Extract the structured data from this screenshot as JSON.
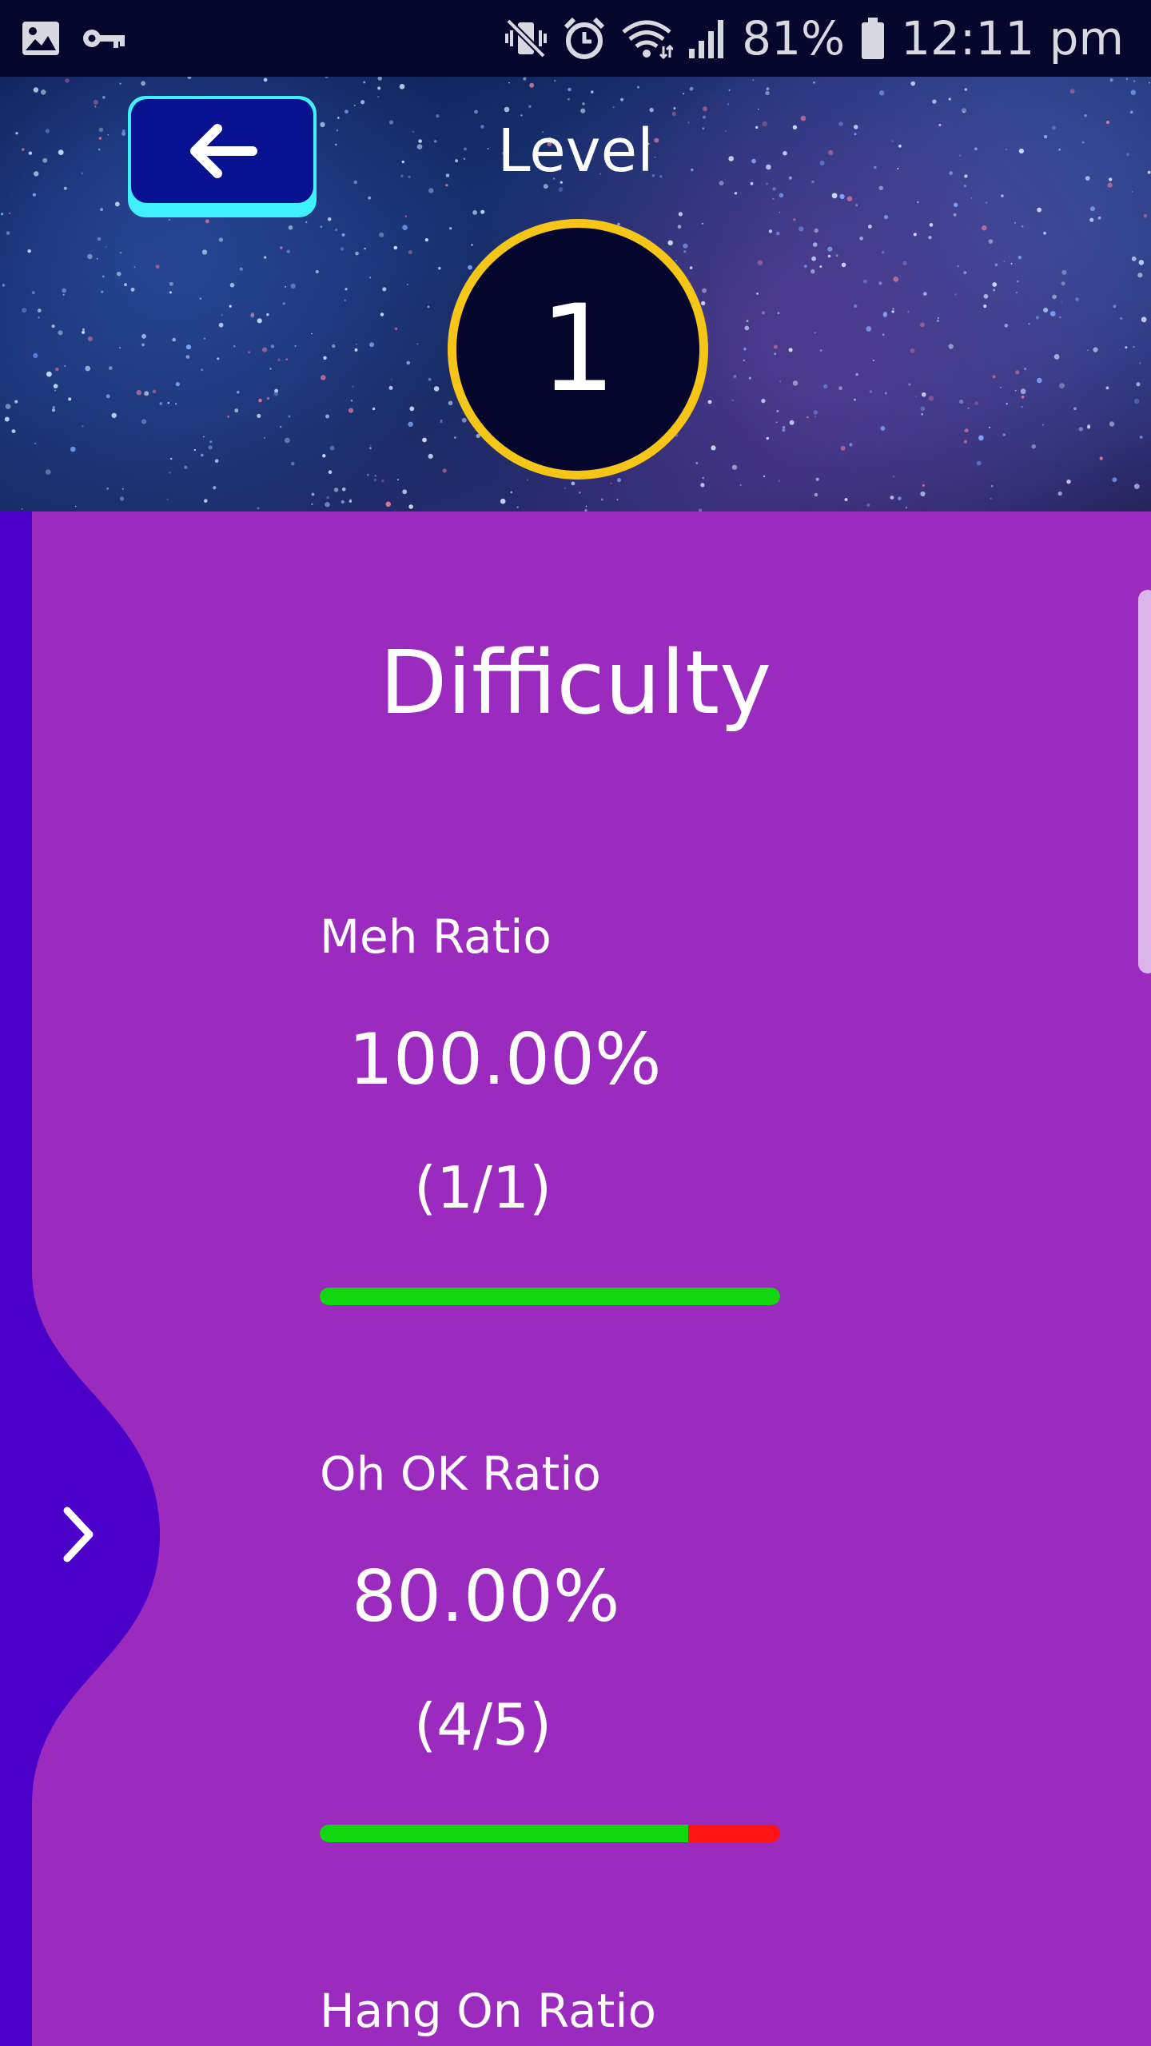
{
  "status_bar": {
    "battery": "81%",
    "time": "12:11 pm",
    "icons": [
      "image-icon",
      "key-icon",
      "mute-vibrate-icon",
      "alarm-icon",
      "wifi-icon",
      "signal-icon",
      "battery-icon"
    ]
  },
  "header": {
    "back_icon": "arrow-left-icon",
    "title": "Level",
    "level_number": "1"
  },
  "content": {
    "title": "Difficulty",
    "stats": [
      {
        "label": "Meh Ratio",
        "value": "100.00%",
        "count": "(1/1)",
        "ratio": 1.0
      },
      {
        "label": "Oh OK Ratio",
        "value": "80.00%",
        "count": "(4/5)",
        "ratio": 0.8
      },
      {
        "label": "Hang On Ratio"
      }
    ]
  },
  "drawer": {
    "toggle_icon": "chevron-right-icon"
  },
  "colors": {
    "background": "#9b2bbf",
    "drawer": "#4a00c8",
    "bar_good": "#0fd60f",
    "bar_bad": "#ff1414",
    "badge_ring": "#f5c518",
    "back_button": "#08118f",
    "back_button_edge": "#3ff0ff"
  }
}
